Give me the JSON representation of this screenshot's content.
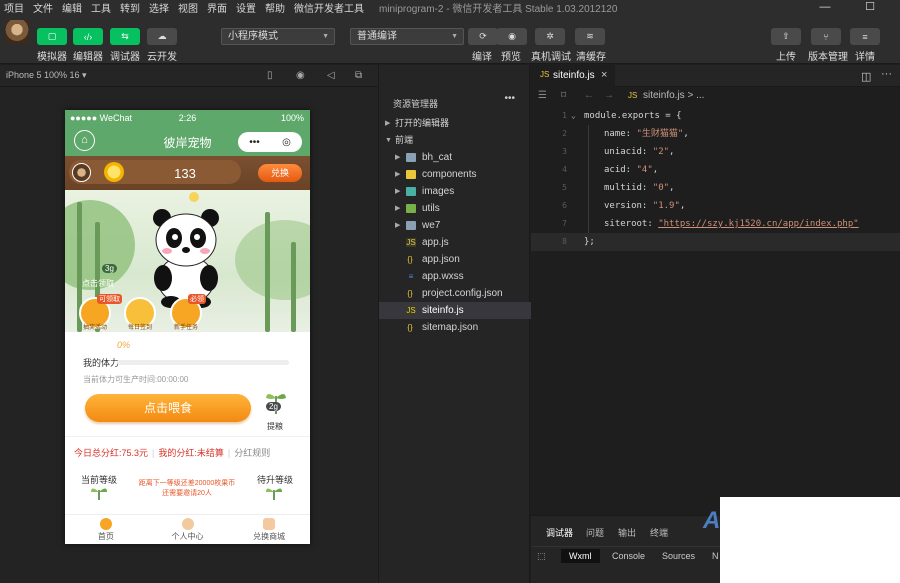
{
  "menu": {
    "items": [
      "项目",
      "文件",
      "编辑",
      "工具",
      "转到",
      "选择",
      "视图",
      "界面",
      "设置",
      "帮助",
      "微信开发者工具"
    ],
    "window_title": "miniprogram-2 - 微信开发者工具 Stable 1.03.2012120"
  },
  "toolbar": {
    "simulator_label": "模拟器",
    "editor_label": "编辑器",
    "debugger_label": "调试器",
    "cloud_label": "云开发",
    "mode_select": "小程序模式",
    "compile_select": "普通编译",
    "compile_label": "编译",
    "preview_label": "预览",
    "device_debug_label": "真机调试",
    "clear_cache_label": "清缓存",
    "upload_label": "上传",
    "version_label": "版本管理",
    "details_label": "详情",
    "simulator_icon_text": "▢",
    "editor_icon_text": "‹/›",
    "debugger_icon_text": "⇆",
    "cloud_icon_text": "☁"
  },
  "subbar": {
    "device": "iPhone 5 100% 16 ▾"
  },
  "phone": {
    "carrier": "●●●●● WeChat",
    "time": "2:26",
    "battery": "100%",
    "title": "彼岸宠物",
    "capsule_more": "•••",
    "capsule_close": "◎",
    "score": "133",
    "exchange": "兑换",
    "scene_badge": "3g",
    "scene_label": "点击领取",
    "icons": [
      {
        "tag": "可领取",
        "caption": "抽奖活动"
      },
      {
        "tag": "",
        "caption": "每日签到"
      },
      {
        "tag": "必领",
        "caption": "新手任务"
      }
    ],
    "stamina_pct": "0%",
    "stamina_fraction": 0,
    "stamina_label": "我的体力",
    "stamina_note": "当前体力可生产时间:00:00:00",
    "feed_button": "点击喂食",
    "timing_badge": "2g",
    "timing_label": "提粮",
    "bonus_total": "今日总分红:75.3元",
    "bonus_mine": "我的分红:未结算",
    "bonus_rules": "分红规则",
    "level_current": "当前等级",
    "level_next": "待升等级",
    "level_note_1": "距离下一等级还差20000枚果币",
    "level_note_2": "还需要邀请20人",
    "tabs": [
      "首页",
      "个人中心",
      "兑换商城"
    ]
  },
  "explorer": {
    "title": "资源管理器",
    "more": "•••",
    "open_editors": "打开的编辑器",
    "root": "前端",
    "items": [
      {
        "name": "bh_cat",
        "type": "folder",
        "icon": "folder-icon"
      },
      {
        "name": "components",
        "type": "folder",
        "icon": "folder-icon"
      },
      {
        "name": "images",
        "type": "folder",
        "icon": "folder-icon"
      },
      {
        "name": "utils",
        "type": "folder",
        "icon": "folder-icon"
      },
      {
        "name": "we7",
        "type": "folder",
        "icon": "folder-icon"
      },
      {
        "name": "app.js",
        "type": "js",
        "icon": "js-icon"
      },
      {
        "name": "app.json",
        "type": "json",
        "icon": "json-icon"
      },
      {
        "name": "app.wxss",
        "type": "wxss",
        "icon": "css-icon"
      },
      {
        "name": "project.config.json",
        "type": "json",
        "icon": "json-icon"
      },
      {
        "name": "siteinfo.js",
        "type": "js",
        "icon": "js-icon",
        "selected": true
      },
      {
        "name": "sitemap.json",
        "type": "json",
        "icon": "json-icon"
      }
    ]
  },
  "editor": {
    "tab_name": "siteinfo.js",
    "breadcrumb": "siteinfo.js > ...",
    "lines": [
      {
        "n": "1",
        "code": "module.exports = {"
      },
      {
        "n": "2",
        "key": "name: ",
        "val": "\"生财猫猫\"",
        "tail": ","
      },
      {
        "n": "3",
        "key": "uniacid: ",
        "val": "\"2\"",
        "tail": ","
      },
      {
        "n": "4",
        "key": "acid: ",
        "val": "\"4\"",
        "tail": ","
      },
      {
        "n": "5",
        "key": "multiid: ",
        "val": "\"0\"",
        "tail": ","
      },
      {
        "n": "6",
        "key": "version: ",
        "val": "\"1.9\"",
        "tail": ","
      },
      {
        "n": "7",
        "key": "siteroot: ",
        "val": "\"https://szy.kj1520.cn/app/index.php\"",
        "tail": ""
      },
      {
        "n": "8",
        "code": "};"
      }
    ]
  },
  "panel": {
    "tabs": [
      "调试器",
      "问题",
      "输出",
      "终端"
    ],
    "devtools": [
      "Wxml",
      "Console",
      "Sources",
      "N"
    ]
  },
  "colors": {
    "accent_green": "#07c160",
    "nav_green": "#5fa86b",
    "orange": "#f28a12"
  }
}
